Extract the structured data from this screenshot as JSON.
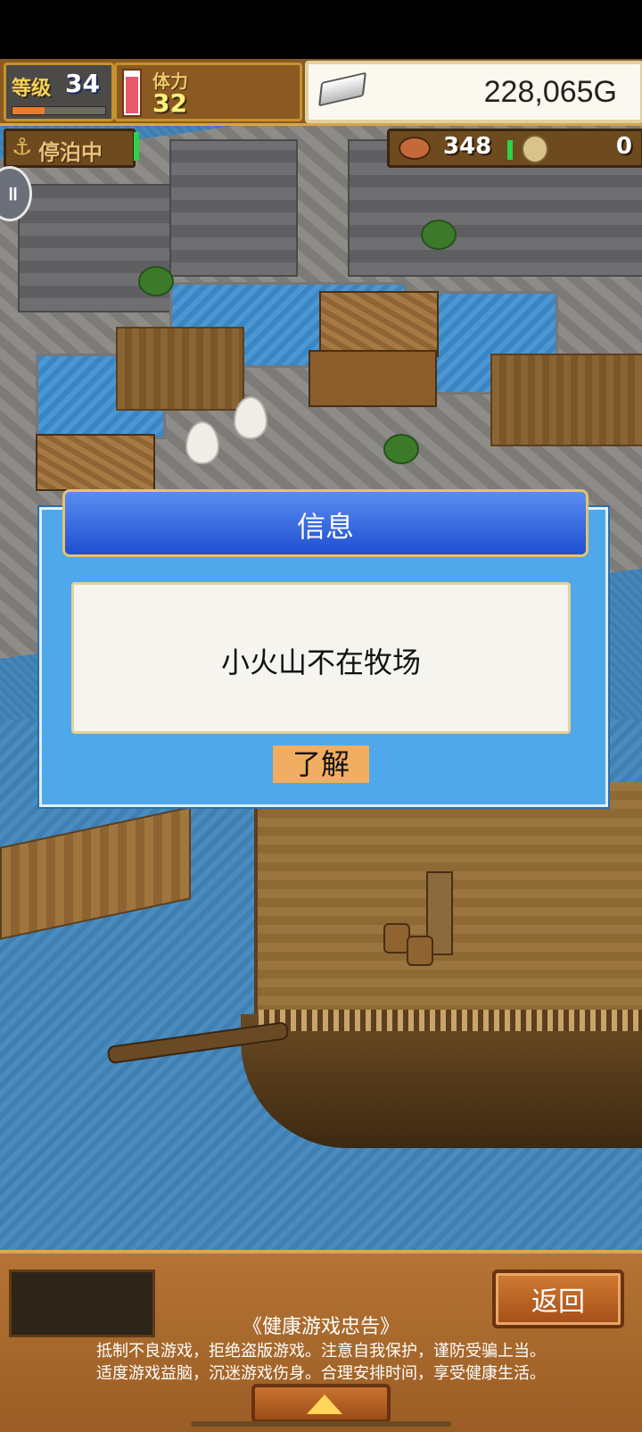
{
  "hud": {
    "level_label": "等级",
    "level_value": "34",
    "level_progress": 0.35,
    "stamina_label": "体力",
    "stamina_value": "32",
    "stamina_level": 0.9,
    "money": "228,065G"
  },
  "status": {
    "mooring_label": "停泊中",
    "food_count": "348",
    "coin_count": "0"
  },
  "dialog": {
    "title": "信息",
    "message": "小火山不在牧场",
    "ok_label": "了解"
  },
  "bottom": {
    "back_label": "返回",
    "notice_title": "《健康游戏忠告》",
    "notice_line1": "抵制不良游戏，拒绝盗版游戏。注意自我保护，谨防受骗上当。",
    "notice_line2": "适度游戏益脑，沉迷游戏伤身。合理安排时间，享受健康生活。"
  },
  "icons": {
    "anchor": "anchor-icon",
    "silver": "silver-ingot-icon",
    "food": "meat-icon",
    "coin": "coin-icon",
    "expand": "triangle-up-icon"
  },
  "colors": {
    "dialog_bg": "#4ea8ea",
    "title_bar": "#2a5fe0",
    "ok_button": "#f1ad62",
    "panel_wood": "#a8672c"
  }
}
